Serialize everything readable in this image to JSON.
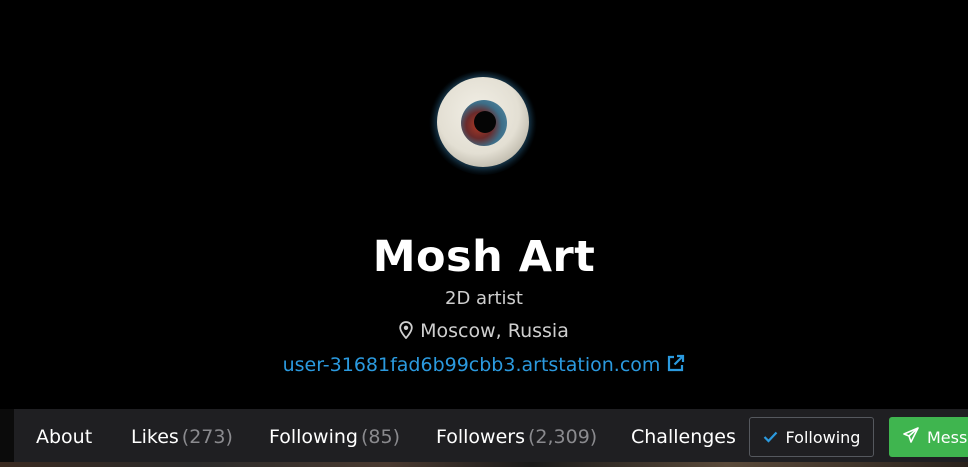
{
  "profile": {
    "name": "Mosh Art",
    "headline": "2D artist",
    "location": "Moscow, Russia",
    "website": "user-31681fad6b99cbb3.artstation.com"
  },
  "icons": {
    "avatar": "eye-avatar",
    "location": "map-pin-icon",
    "external": "external-link-icon",
    "check": "check-icon",
    "message": "paper-plane-icon"
  },
  "nav": {
    "about": "About",
    "likes_label": "Likes",
    "likes_count": "(273)",
    "following_label": "Following",
    "following_count": "(85)",
    "followers_label": "Followers",
    "followers_count": "(2,309)",
    "challenges": "Challenges"
  },
  "actions": {
    "following_button": "Following",
    "message_button": "Message"
  },
  "colors": {
    "link": "#2b9adf",
    "message_button": "#3fb54f",
    "nav_background": "#1f1f22"
  }
}
